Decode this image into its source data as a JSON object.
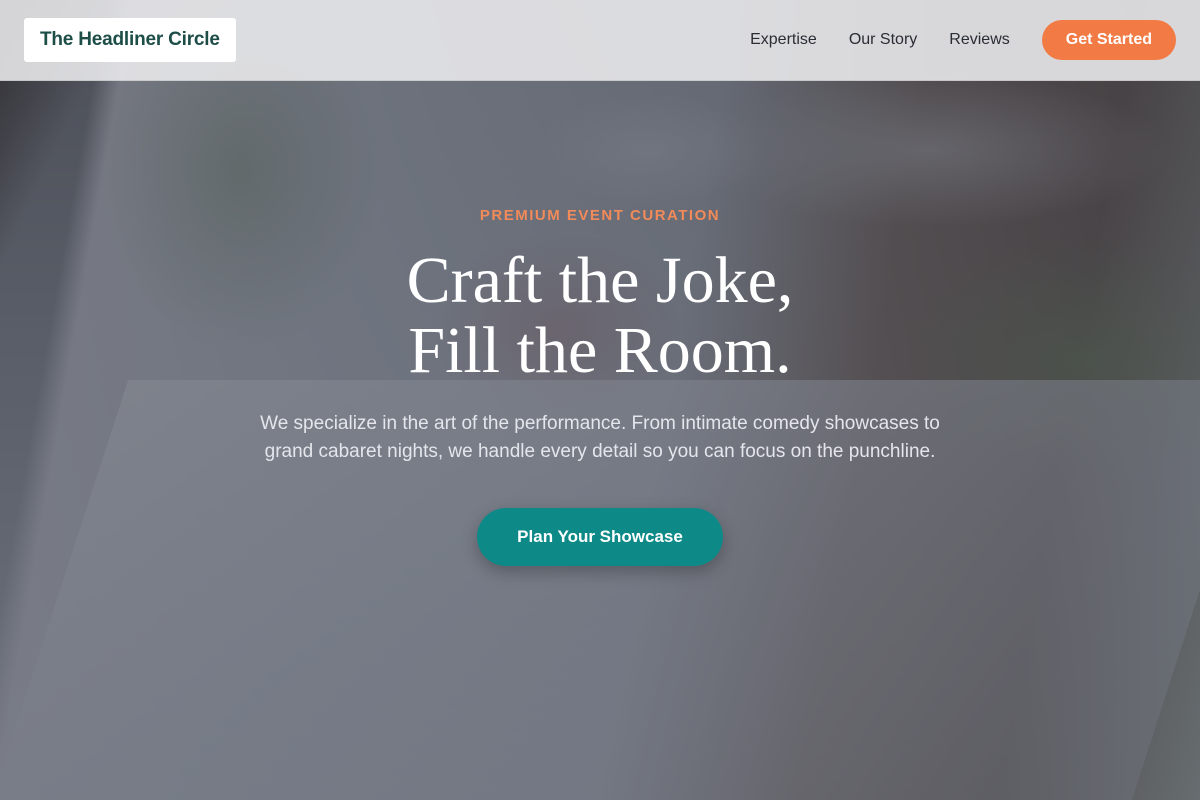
{
  "header": {
    "logo": "The Headliner Circle",
    "nav": [
      {
        "label": "Expertise"
      },
      {
        "label": "Our Story"
      },
      {
        "label": "Reviews"
      }
    ],
    "cta_label": "Get Started"
  },
  "hero": {
    "eyebrow": "PREMIUM EVENT CURATION",
    "headline_line1": "Craft the Joke,",
    "headline_line2": "Fill the Room.",
    "subtext": "We specialize in the art of the performance. From intimate comedy showcases to grand cabaret nights, we handle every detail so you can focus on the punchline.",
    "button_label": "Plan Your Showcase"
  },
  "colors": {
    "accent_orange": "#f27a45",
    "accent_teal": "#0d8a88",
    "brand_green": "#1d4d47"
  }
}
